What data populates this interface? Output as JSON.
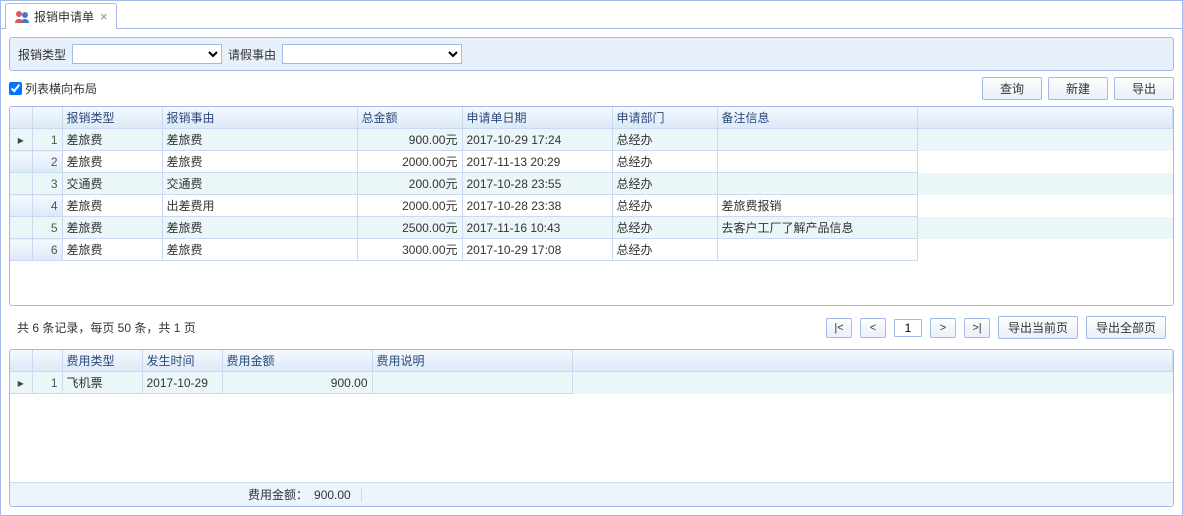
{
  "tab": {
    "title": "报销申请单",
    "icon": "people-icon"
  },
  "filters": {
    "type_label": "报销类型",
    "reason_label": "请假事由"
  },
  "toolbar": {
    "layout_checkbox": "列表横向布局",
    "query": "查询",
    "create": "新建",
    "export": "导出"
  },
  "grid1": {
    "columns": [
      "报销类型",
      "报销事由",
      "总金额",
      "申请单日期",
      "申请部门",
      "备注信息"
    ],
    "rows": [
      {
        "n": 1,
        "type": "差旅费",
        "reason": "差旅费",
        "amount": "900.00元",
        "date": "2017-10-29 17:24",
        "dept": "总经办",
        "remark": "",
        "marker": "▸"
      },
      {
        "n": 2,
        "type": "差旅费",
        "reason": "差旅费",
        "amount": "2000.00元",
        "date": "2017-11-13 20:29",
        "dept": "总经办",
        "remark": ""
      },
      {
        "n": 3,
        "type": "交通费",
        "reason": "交通费",
        "amount": "200.00元",
        "date": "2017-10-28 23:55",
        "dept": "总经办",
        "remark": ""
      },
      {
        "n": 4,
        "type": "差旅费",
        "reason": "出差费用",
        "amount": "2000.00元",
        "date": "2017-10-28 23:38",
        "dept": "总经办",
        "remark": "差旅费报销"
      },
      {
        "n": 5,
        "type": "差旅费",
        "reason": "差旅费",
        "amount": "2500.00元",
        "date": "2017-11-16 10:43",
        "dept": "总经办",
        "remark": "去客户工厂了解产品信息"
      },
      {
        "n": 6,
        "type": "差旅费",
        "reason": "差旅费",
        "amount": "3000.00元",
        "date": "2017-10-29 17:08",
        "dept": "总经办",
        "remark": ""
      }
    ]
  },
  "pager": {
    "summary": "共 6 条记录，每页 50 条，共 1 页",
    "first": "|<",
    "prev": "<",
    "page": "1",
    "next": ">",
    "last": ">|",
    "export_current": "导出当前页",
    "export_all": "导出全部页"
  },
  "grid2": {
    "columns": [
      "费用类型",
      "发生时间",
      "费用金额",
      "费用说明"
    ],
    "rows": [
      {
        "n": 1,
        "type": "飞机票",
        "date": "2017-10-29",
        "amount": "900.00",
        "desc": "",
        "marker": "▸"
      }
    ]
  },
  "footer": {
    "label": "费用金额：",
    "value": "900.00"
  }
}
